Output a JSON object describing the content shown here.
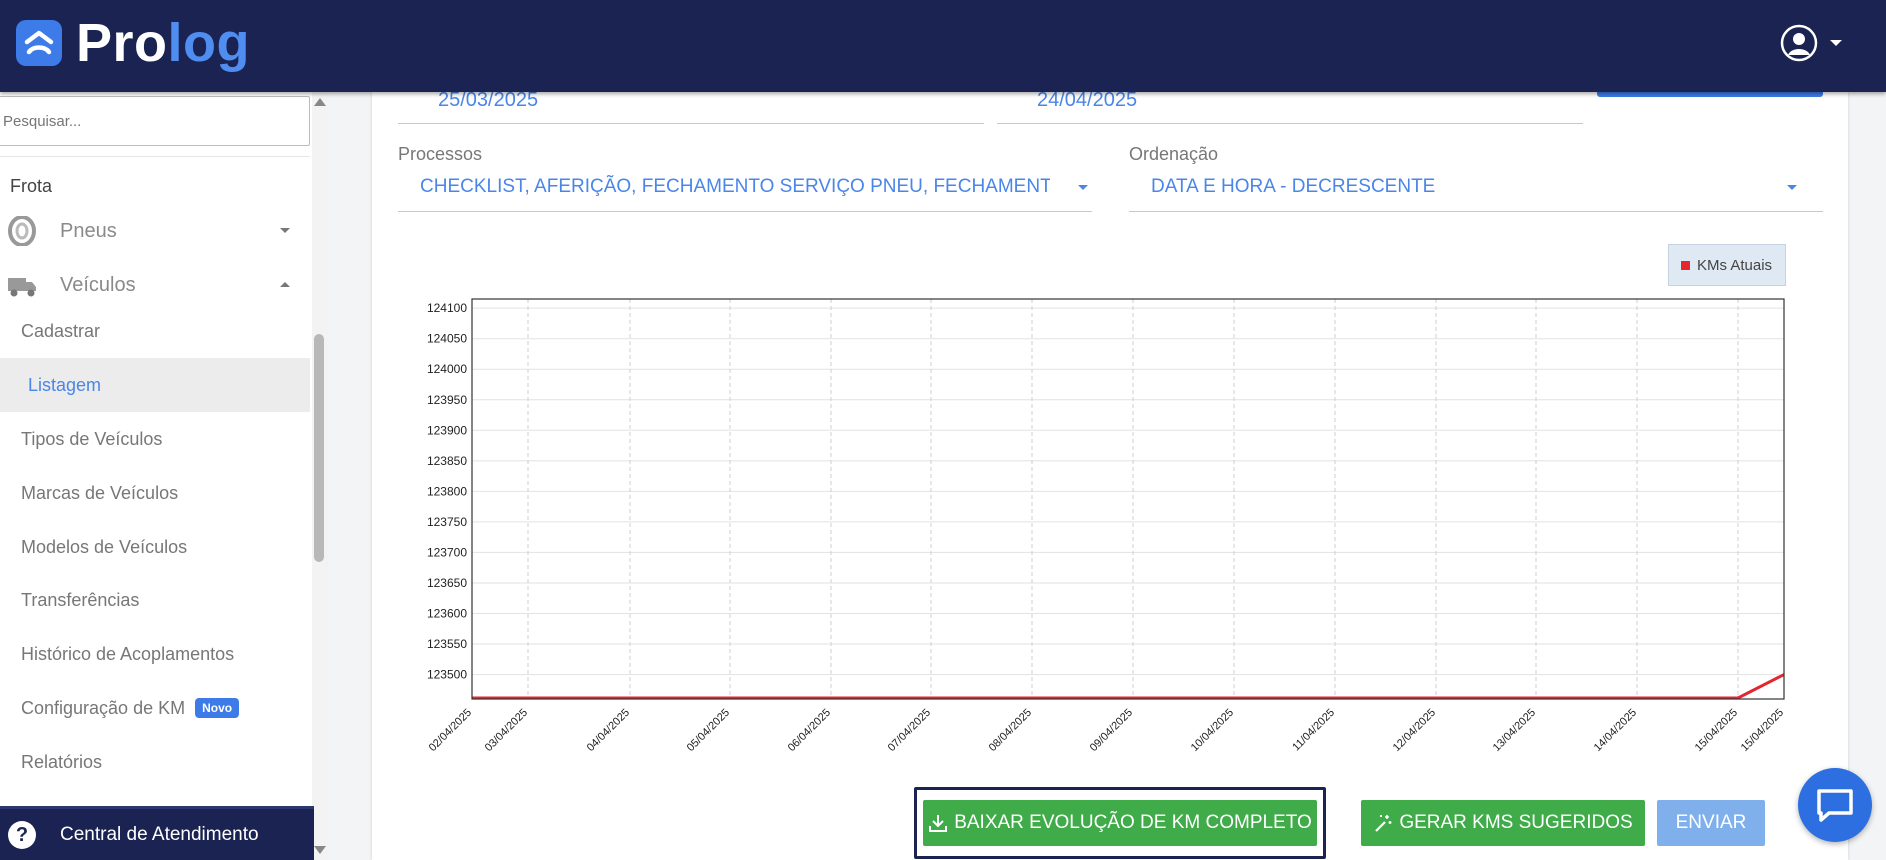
{
  "header": {
    "logo_part1": "Pro",
    "logo_part2": "log",
    "user_icon": "user-circle-icon"
  },
  "sidebar": {
    "search_placeholder": "Pesquisar...",
    "section_title": "Frota",
    "groups": [
      {
        "label": "Pneus",
        "icon": "tire-icon",
        "expanded": false
      },
      {
        "label": "Veículos",
        "icon": "truck-icon",
        "expanded": true
      }
    ],
    "items": [
      {
        "label": "Cadastrar"
      },
      {
        "label": "Listagem",
        "active": true
      },
      {
        "label": "Tipos de Veículos"
      },
      {
        "label": "Marcas de Veículos"
      },
      {
        "label": "Modelos de Veículos"
      },
      {
        "label": "Transferências"
      },
      {
        "label": "Histórico de Acoplamentos"
      },
      {
        "label": "Configuração de KM",
        "badge": "Novo"
      },
      {
        "label": "Relatórios"
      }
    ],
    "help_label": "Central de Atendimento"
  },
  "filters": {
    "date_start": "25/03/2025",
    "date_end": "24/04/2025",
    "processos_label": "Processos",
    "processos_value": "CHECKLIST, AFERIÇÃO, FECHAMENTO SERVIÇO PNEU, FECHAMENTO (",
    "ordenacao_label": "Ordenação",
    "ordenacao_value": "DATA E HORA - DECRESCENTE"
  },
  "legend": {
    "label": "KMs Atuais",
    "color": "#e3262f"
  },
  "chart_data": {
    "type": "line",
    "x": [
      "02/04/2025",
      "03/04/2025",
      "04/04/2025",
      "05/04/2025",
      "06/04/2025",
      "07/04/2025",
      "08/04/2025",
      "09/04/2025",
      "10/04/2025",
      "11/04/2025",
      "12/04/2025",
      "13/04/2025",
      "14/04/2025",
      "15/04/2025",
      "15/04/2025"
    ],
    "y_ticks": [
      124100,
      124050,
      124000,
      123950,
      123900,
      123850,
      123800,
      123750,
      123700,
      123650,
      123600,
      123550,
      123500
    ],
    "ylim": [
      123460,
      124115
    ],
    "series": [
      {
        "name": "KMs Atuais",
        "color": "#e3262f",
        "values": [
          123460,
          123460,
          123460,
          123460,
          123460,
          123460,
          123460,
          123460,
          123460,
          123460,
          123460,
          123460,
          123460,
          123460,
          123500
        ]
      }
    ],
    "grid": true
  },
  "actions": {
    "download_label": "BAIXAR EVOLUÇÃO DE KM COMPLETO",
    "generate_label": "GERAR KMS SUGERIDOS",
    "send_label": "ENVIAR"
  }
}
